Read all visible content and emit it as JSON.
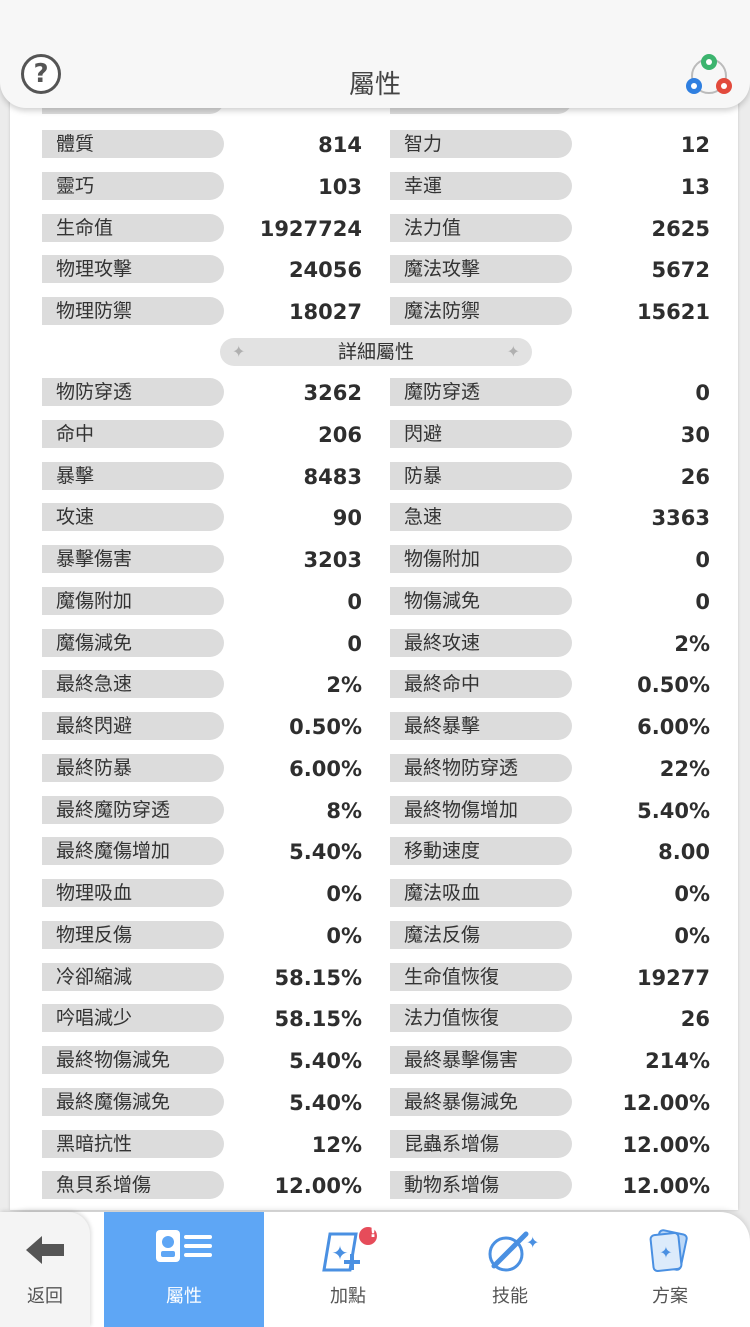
{
  "header": {
    "title": "屬性",
    "help_label": "?"
  },
  "section_label": "詳細屬性",
  "base_rows": [
    {
      "l": "體質",
      "lv": "814",
      "r": "智力",
      "rv": "12"
    },
    {
      "l": "靈巧",
      "lv": "103",
      "r": "幸運",
      "rv": "13"
    },
    {
      "l": "生命值",
      "lv": "1927724",
      "r": "法力值",
      "rv": "2625"
    },
    {
      "l": "物理攻擊",
      "lv": "24056",
      "r": "魔法攻擊",
      "rv": "5672"
    },
    {
      "l": "物理防禦",
      "lv": "18027",
      "r": "魔法防禦",
      "rv": "15621"
    }
  ],
  "detail_rows": [
    {
      "l": "物防穿透",
      "lv": "3262",
      "r": "魔防穿透",
      "rv": "0"
    },
    {
      "l": "命中",
      "lv": "206",
      "r": "閃避",
      "rv": "30"
    },
    {
      "l": "暴擊",
      "lv": "8483",
      "r": "防暴",
      "rv": "26"
    },
    {
      "l": "攻速",
      "lv": "90",
      "r": "急速",
      "rv": "3363"
    },
    {
      "l": "暴擊傷害",
      "lv": "3203",
      "r": "物傷附加",
      "rv": "0"
    },
    {
      "l": "魔傷附加",
      "lv": "0",
      "r": "物傷減免",
      "rv": "0"
    },
    {
      "l": "魔傷減免",
      "lv": "0",
      "r": "最終攻速",
      "rv": "2%"
    },
    {
      "l": "最終急速",
      "lv": "2%",
      "r": "最終命中",
      "rv": "0.50%"
    },
    {
      "l": "最終閃避",
      "lv": "0.50%",
      "r": "最終暴擊",
      "rv": "6.00%"
    },
    {
      "l": "最終防暴",
      "lv": "6.00%",
      "r": "最終物防穿透",
      "rv": "22%"
    },
    {
      "l": "最終魔防穿透",
      "lv": "8%",
      "r": "最終物傷增加",
      "rv": "5.40%"
    },
    {
      "l": "最終魔傷增加",
      "lv": "5.40%",
      "r": "移動速度",
      "rv": "8.00"
    },
    {
      "l": "物理吸血",
      "lv": "0%",
      "r": "魔法吸血",
      "rv": "0%"
    },
    {
      "l": "物理反傷",
      "lv": "0%",
      "r": "魔法反傷",
      "rv": "0%"
    },
    {
      "l": "冷卻縮減",
      "lv": "58.15%",
      "r": "生命值恢復",
      "rv": "19277"
    },
    {
      "l": "吟唱減少",
      "lv": "58.15%",
      "r": "法力值恢復",
      "rv": "26"
    },
    {
      "l": "最終物傷減免",
      "lv": "5.40%",
      "r": "最終暴擊傷害",
      "rv": "214%"
    },
    {
      "l": "最終魔傷減免",
      "lv": "5.40%",
      "r": "最終暴傷減免",
      "rv": "12.00%"
    },
    {
      "l": "黑暗抗性",
      "lv": "12%",
      "r": "昆蟲系增傷",
      "rv": "12.00%"
    },
    {
      "l": "魚貝系增傷",
      "lv": "12.00%",
      "r": "動物系增傷",
      "rv": "12.00%"
    }
  ],
  "nav": {
    "back": "返回",
    "items": [
      {
        "label": "屬性",
        "icon": "attribute-card-icon",
        "active": true
      },
      {
        "label": "加點",
        "icon": "add-points-icon",
        "badge": "!"
      },
      {
        "label": "技能",
        "icon": "skill-icon"
      },
      {
        "label": "方案",
        "icon": "plan-cards-icon"
      }
    ]
  },
  "colors": {
    "active_tab": "#5ea6f5",
    "pill": "#dcdcdc",
    "badge": "#e64c5a"
  }
}
